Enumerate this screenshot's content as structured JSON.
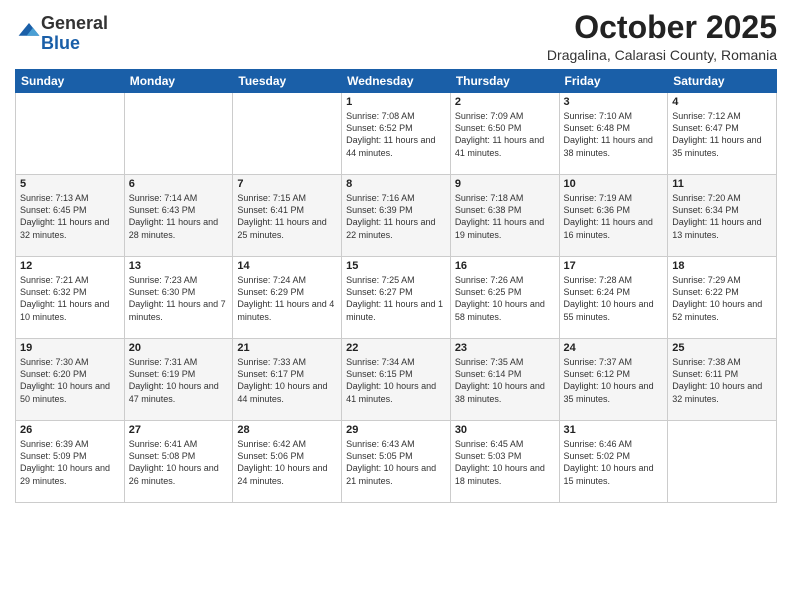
{
  "header": {
    "logo_general": "General",
    "logo_blue": "Blue",
    "month_title": "October 2025",
    "location": "Dragalina, Calarasi County, Romania"
  },
  "weekdays": [
    "Sunday",
    "Monday",
    "Tuesday",
    "Wednesday",
    "Thursday",
    "Friday",
    "Saturday"
  ],
  "weeks": [
    [
      {
        "day": "",
        "info": ""
      },
      {
        "day": "",
        "info": ""
      },
      {
        "day": "",
        "info": ""
      },
      {
        "day": "1",
        "info": "Sunrise: 7:08 AM\nSunset: 6:52 PM\nDaylight: 11 hours\nand 44 minutes."
      },
      {
        "day": "2",
        "info": "Sunrise: 7:09 AM\nSunset: 6:50 PM\nDaylight: 11 hours\nand 41 minutes."
      },
      {
        "day": "3",
        "info": "Sunrise: 7:10 AM\nSunset: 6:48 PM\nDaylight: 11 hours\nand 38 minutes."
      },
      {
        "day": "4",
        "info": "Sunrise: 7:12 AM\nSunset: 6:47 PM\nDaylight: 11 hours\nand 35 minutes."
      }
    ],
    [
      {
        "day": "5",
        "info": "Sunrise: 7:13 AM\nSunset: 6:45 PM\nDaylight: 11 hours\nand 32 minutes."
      },
      {
        "day": "6",
        "info": "Sunrise: 7:14 AM\nSunset: 6:43 PM\nDaylight: 11 hours\nand 28 minutes."
      },
      {
        "day": "7",
        "info": "Sunrise: 7:15 AM\nSunset: 6:41 PM\nDaylight: 11 hours\nand 25 minutes."
      },
      {
        "day": "8",
        "info": "Sunrise: 7:16 AM\nSunset: 6:39 PM\nDaylight: 11 hours\nand 22 minutes."
      },
      {
        "day": "9",
        "info": "Sunrise: 7:18 AM\nSunset: 6:38 PM\nDaylight: 11 hours\nand 19 minutes."
      },
      {
        "day": "10",
        "info": "Sunrise: 7:19 AM\nSunset: 6:36 PM\nDaylight: 11 hours\nand 16 minutes."
      },
      {
        "day": "11",
        "info": "Sunrise: 7:20 AM\nSunset: 6:34 PM\nDaylight: 11 hours\nand 13 minutes."
      }
    ],
    [
      {
        "day": "12",
        "info": "Sunrise: 7:21 AM\nSunset: 6:32 PM\nDaylight: 11 hours\nand 10 minutes."
      },
      {
        "day": "13",
        "info": "Sunrise: 7:23 AM\nSunset: 6:30 PM\nDaylight: 11 hours\nand 7 minutes."
      },
      {
        "day": "14",
        "info": "Sunrise: 7:24 AM\nSunset: 6:29 PM\nDaylight: 11 hours\nand 4 minutes."
      },
      {
        "day": "15",
        "info": "Sunrise: 7:25 AM\nSunset: 6:27 PM\nDaylight: 11 hours\nand 1 minute."
      },
      {
        "day": "16",
        "info": "Sunrise: 7:26 AM\nSunset: 6:25 PM\nDaylight: 10 hours\nand 58 minutes."
      },
      {
        "day": "17",
        "info": "Sunrise: 7:28 AM\nSunset: 6:24 PM\nDaylight: 10 hours\nand 55 minutes."
      },
      {
        "day": "18",
        "info": "Sunrise: 7:29 AM\nSunset: 6:22 PM\nDaylight: 10 hours\nand 52 minutes."
      }
    ],
    [
      {
        "day": "19",
        "info": "Sunrise: 7:30 AM\nSunset: 6:20 PM\nDaylight: 10 hours\nand 50 minutes."
      },
      {
        "day": "20",
        "info": "Sunrise: 7:31 AM\nSunset: 6:19 PM\nDaylight: 10 hours\nand 47 minutes."
      },
      {
        "day": "21",
        "info": "Sunrise: 7:33 AM\nSunset: 6:17 PM\nDaylight: 10 hours\nand 44 minutes."
      },
      {
        "day": "22",
        "info": "Sunrise: 7:34 AM\nSunset: 6:15 PM\nDaylight: 10 hours\nand 41 minutes."
      },
      {
        "day": "23",
        "info": "Sunrise: 7:35 AM\nSunset: 6:14 PM\nDaylight: 10 hours\nand 38 minutes."
      },
      {
        "day": "24",
        "info": "Sunrise: 7:37 AM\nSunset: 6:12 PM\nDaylight: 10 hours\nand 35 minutes."
      },
      {
        "day": "25",
        "info": "Sunrise: 7:38 AM\nSunset: 6:11 PM\nDaylight: 10 hours\nand 32 minutes."
      }
    ],
    [
      {
        "day": "26",
        "info": "Sunrise: 6:39 AM\nSunset: 5:09 PM\nDaylight: 10 hours\nand 29 minutes."
      },
      {
        "day": "27",
        "info": "Sunrise: 6:41 AM\nSunset: 5:08 PM\nDaylight: 10 hours\nand 26 minutes."
      },
      {
        "day": "28",
        "info": "Sunrise: 6:42 AM\nSunset: 5:06 PM\nDaylight: 10 hours\nand 24 minutes."
      },
      {
        "day": "29",
        "info": "Sunrise: 6:43 AM\nSunset: 5:05 PM\nDaylight: 10 hours\nand 21 minutes."
      },
      {
        "day": "30",
        "info": "Sunrise: 6:45 AM\nSunset: 5:03 PM\nDaylight: 10 hours\nand 18 minutes."
      },
      {
        "day": "31",
        "info": "Sunrise: 6:46 AM\nSunset: 5:02 PM\nDaylight: 10 hours\nand 15 minutes."
      },
      {
        "day": "",
        "info": ""
      }
    ]
  ]
}
